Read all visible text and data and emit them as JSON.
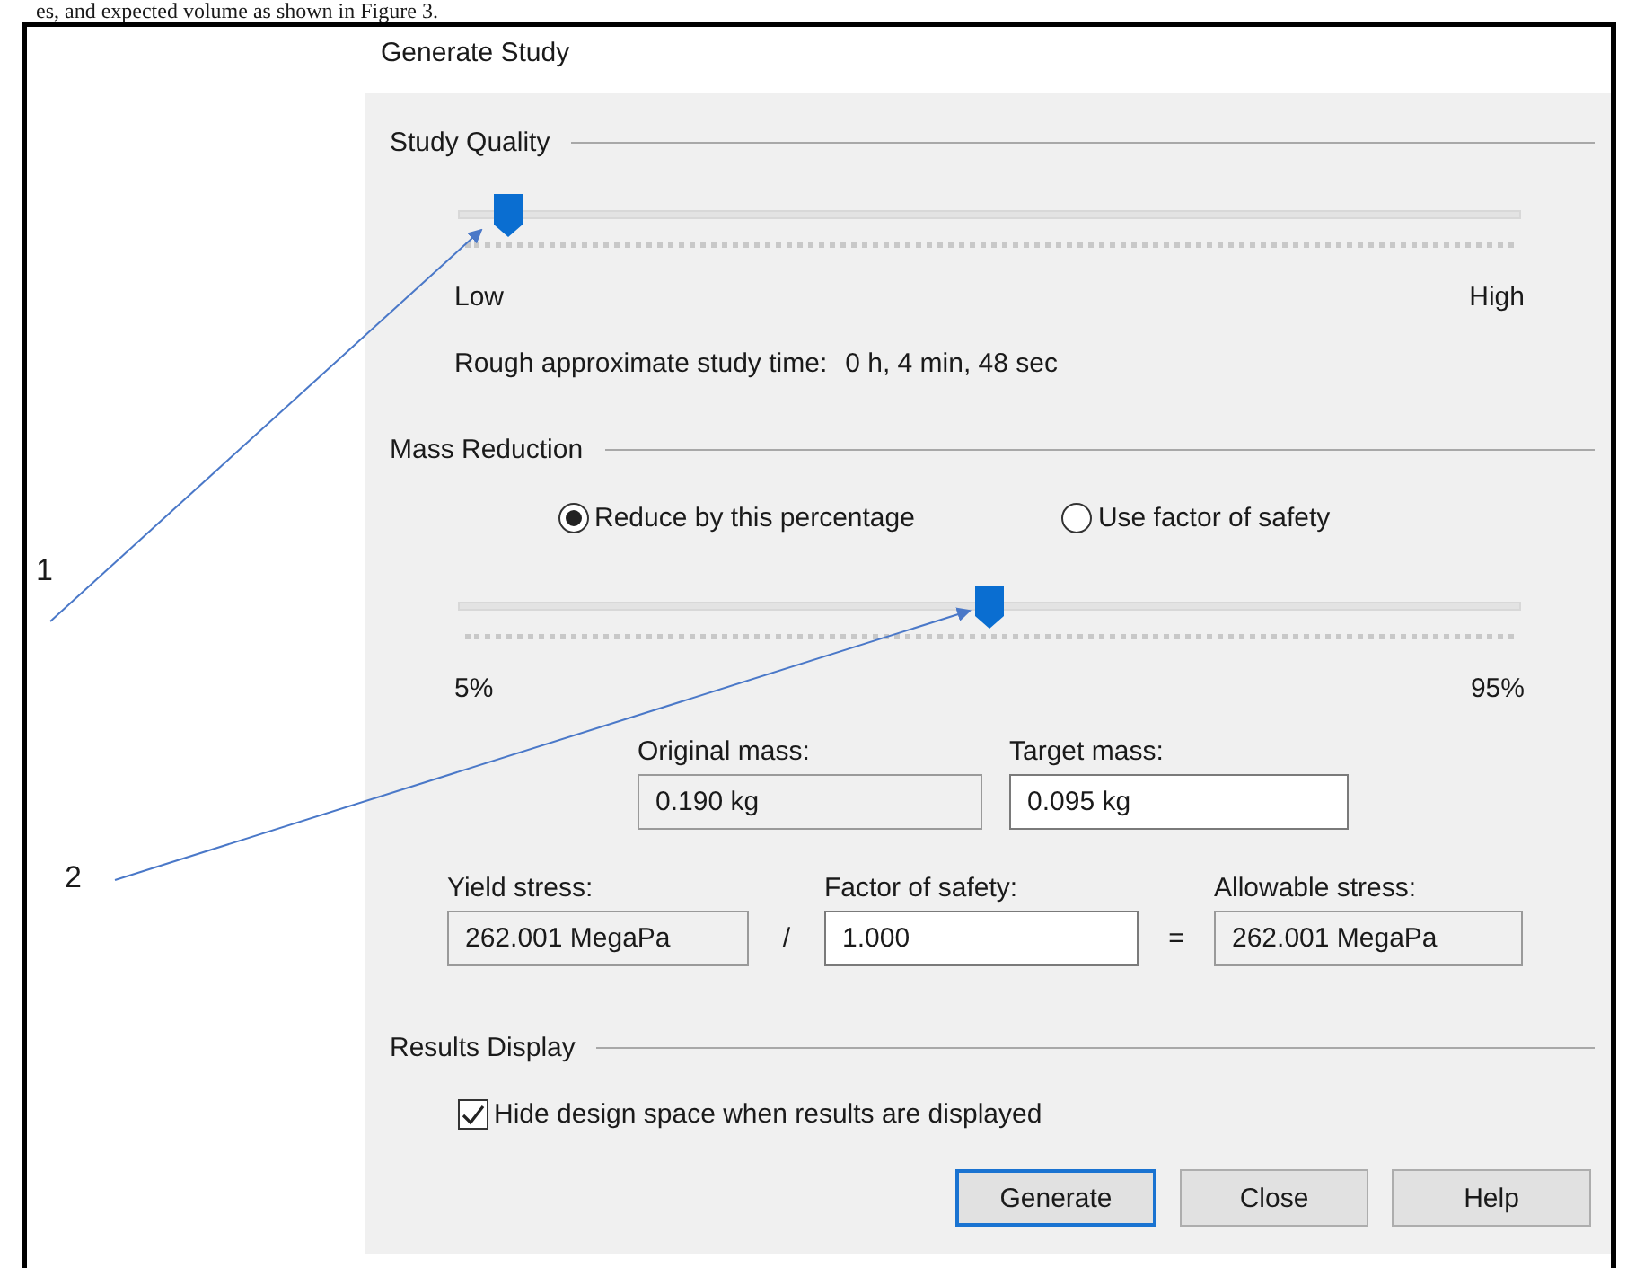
{
  "caption": "es, and expected volume as shown in Figure 3.",
  "annotations": [
    {
      "label": "1"
    },
    {
      "label": "2"
    }
  ],
  "dialog": {
    "title": "Generate Study",
    "study_quality": {
      "heading": "Study Quality",
      "slider": {
        "level": 0.05,
        "min_label": "Low",
        "max_label": "High"
      },
      "time_label": "Rough approximate study time:",
      "time_value": "0 h, 4 min, 48 sec"
    },
    "mass_reduction": {
      "heading": "Mass Reduction",
      "options": [
        {
          "label": "Reduce by this percentage",
          "selected": true
        },
        {
          "label": "Use factor of safety",
          "selected": false
        }
      ],
      "slider": {
        "level": 0.5,
        "min_label": "5%",
        "max_label": "95%"
      },
      "mass_fields": [
        {
          "label": "Original mass:",
          "value": "0.190 kg",
          "disabled": true
        },
        {
          "label": "Target mass:",
          "value": "0.095 kg",
          "disabled": false
        }
      ],
      "stress_fields": [
        {
          "label": "Yield stress:",
          "value": "262.001 MegaPa",
          "disabled": true
        },
        {
          "label": "Factor of safety:",
          "value": "1.000",
          "disabled": false
        },
        {
          "label": "Allowable stress:",
          "value": "262.001 MegaPa",
          "disabled": true
        }
      ],
      "operators": [
        "/",
        "="
      ]
    },
    "results_display": {
      "heading": "Results Display",
      "checkbox": {
        "label": "Hide design space when results are displayed",
        "checked": true
      }
    },
    "buttons": [
      {
        "label": "Generate",
        "focused": true
      },
      {
        "label": "Close",
        "focused": false
      },
      {
        "label": "Help",
        "focused": false
      }
    ]
  }
}
